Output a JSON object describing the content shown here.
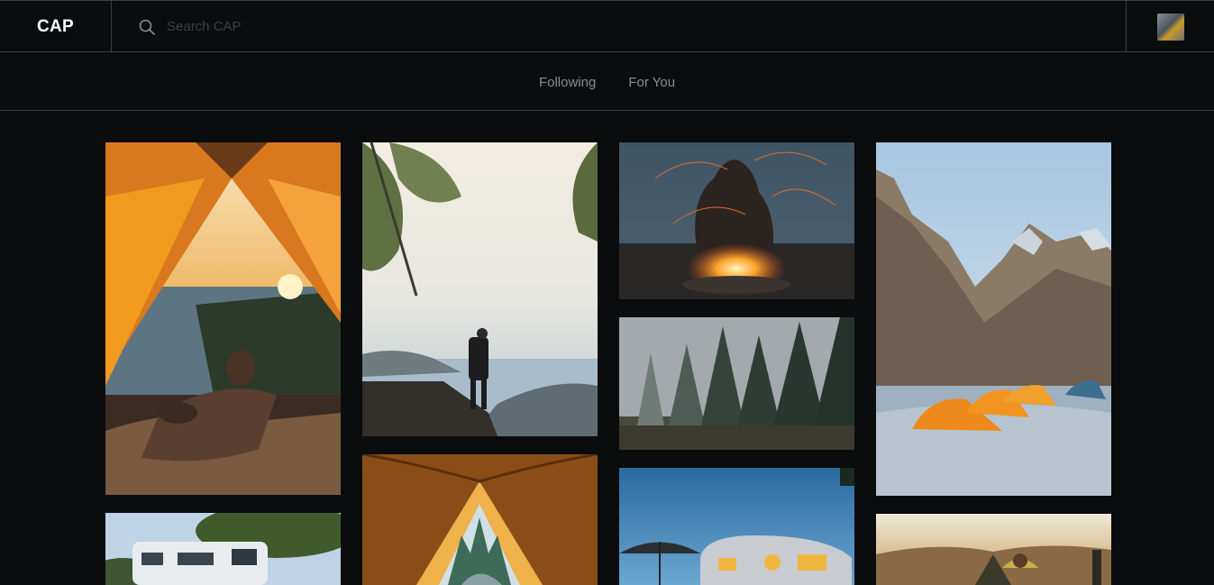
{
  "app": {
    "logo": "CAP"
  },
  "search": {
    "placeholder": "Search CAP",
    "value": "",
    "icon": "search-icon"
  },
  "user": {
    "avatar_alt": "avatar"
  },
  "tabs": [
    {
      "label": "Following"
    },
    {
      "label": "For You"
    }
  ],
  "feed": {
    "photos": [
      {
        "subject": "view from tent over lake at sunset"
      },
      {
        "subject": "hiker on cliff at dawn"
      },
      {
        "subject": "person behind campfire sparks"
      },
      {
        "subject": "misty pine forest"
      },
      {
        "subject": "orange tents by mountain river"
      },
      {
        "subject": "motorhome under pines"
      },
      {
        "subject": "inside tent looking at forest"
      },
      {
        "subject": "vintage trailer with umbrella"
      },
      {
        "subject": "hammocks on mountain at sunset"
      }
    ]
  },
  "colors": {
    "background": "#0b0c0e",
    "border": "#3a3c40",
    "tab_text": "#8a8c91"
  }
}
